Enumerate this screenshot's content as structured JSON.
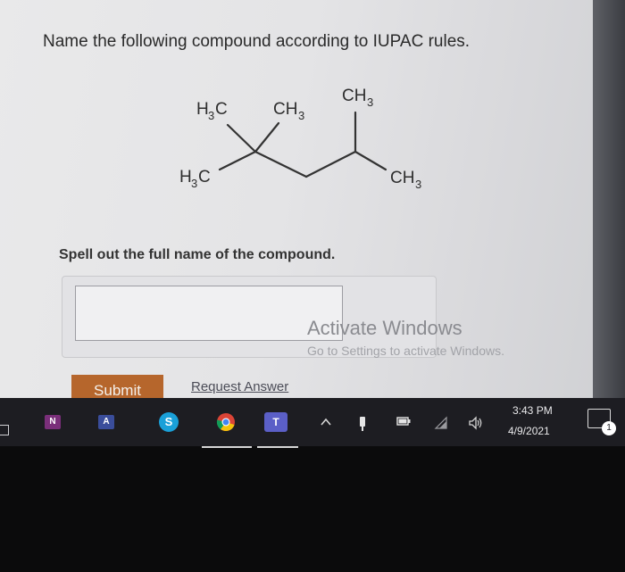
{
  "question": {
    "prompt": "Name the following compound according to IUPAC rules.",
    "structure_labels": {
      "upper_left_methyl": "H3C",
      "upper_mid_methyl": "CH3",
      "upper_right_methyl": "CH3",
      "left_methyl": "H3C",
      "right_methyl": "CH3"
    },
    "instruction": "Spell out the full name of the compound.",
    "answer_value": ""
  },
  "watermark": {
    "title": "Activate Windows",
    "subtitle": "Go to Settings to activate Windows."
  },
  "actions": {
    "submit_label": "Submit",
    "request_answer_label": "Request Answer"
  },
  "taskbar": {
    "apps": [
      {
        "name": "onenote-icon",
        "label": "N"
      },
      {
        "name": "immersive-reader-icon",
        "label": "A"
      },
      {
        "name": "skype-icon",
        "label": "S"
      },
      {
        "name": "chrome-icon",
        "label": ""
      },
      {
        "name": "teams-icon",
        "label": "T"
      }
    ],
    "teams_badge": "1",
    "time": "3:43 PM",
    "date": "4/9/2021",
    "notification_count": "1"
  }
}
